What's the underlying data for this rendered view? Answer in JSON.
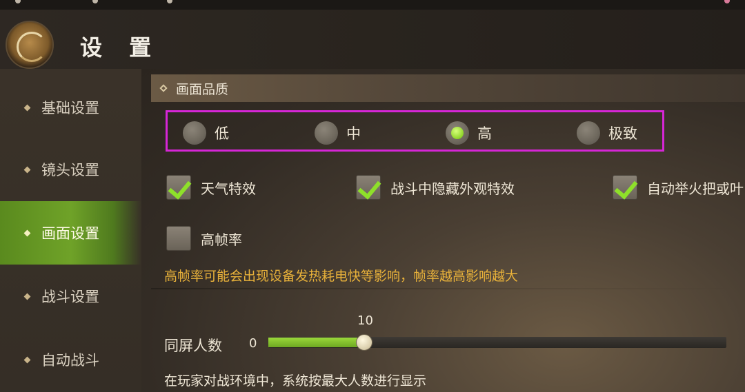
{
  "header": {
    "title": "设 置",
    "logo": "dragon-emblem-icon"
  },
  "sidebar": {
    "items": [
      {
        "label": "基础设置",
        "active": false
      },
      {
        "label": "镜头设置",
        "active": false
      },
      {
        "label": "画面设置",
        "active": true
      },
      {
        "label": "战斗设置",
        "active": false
      },
      {
        "label": "自动战斗",
        "active": false
      }
    ]
  },
  "section": {
    "title": "画面品质"
  },
  "quality": {
    "options": [
      {
        "label": "低",
        "selected": false
      },
      {
        "label": "中",
        "selected": false
      },
      {
        "label": "高",
        "selected": true
      },
      {
        "label": "极致",
        "selected": false
      }
    ]
  },
  "checks": [
    {
      "label": "天气特效",
      "checked": true
    },
    {
      "label": "战斗中隐藏外观特效",
      "checked": true
    },
    {
      "label": "自动举火把或叶",
      "checked": true
    },
    {
      "label": "高帧率",
      "checked": false
    }
  ],
  "framerate_warning": "高帧率可能会出现设备发热耗电快等影响，帧率越高影响越大",
  "players_slider": {
    "label": "同屏人数",
    "min_label": "0",
    "value": 10,
    "value_label": "10",
    "fill_fraction": 0.21,
    "note": "在玩家对战环境中，系统按最大人数进行显示"
  },
  "colors": {
    "accent_green": "#8ee02a",
    "highlight_magenta": "#d626d6",
    "warning": "#e9b23a"
  }
}
